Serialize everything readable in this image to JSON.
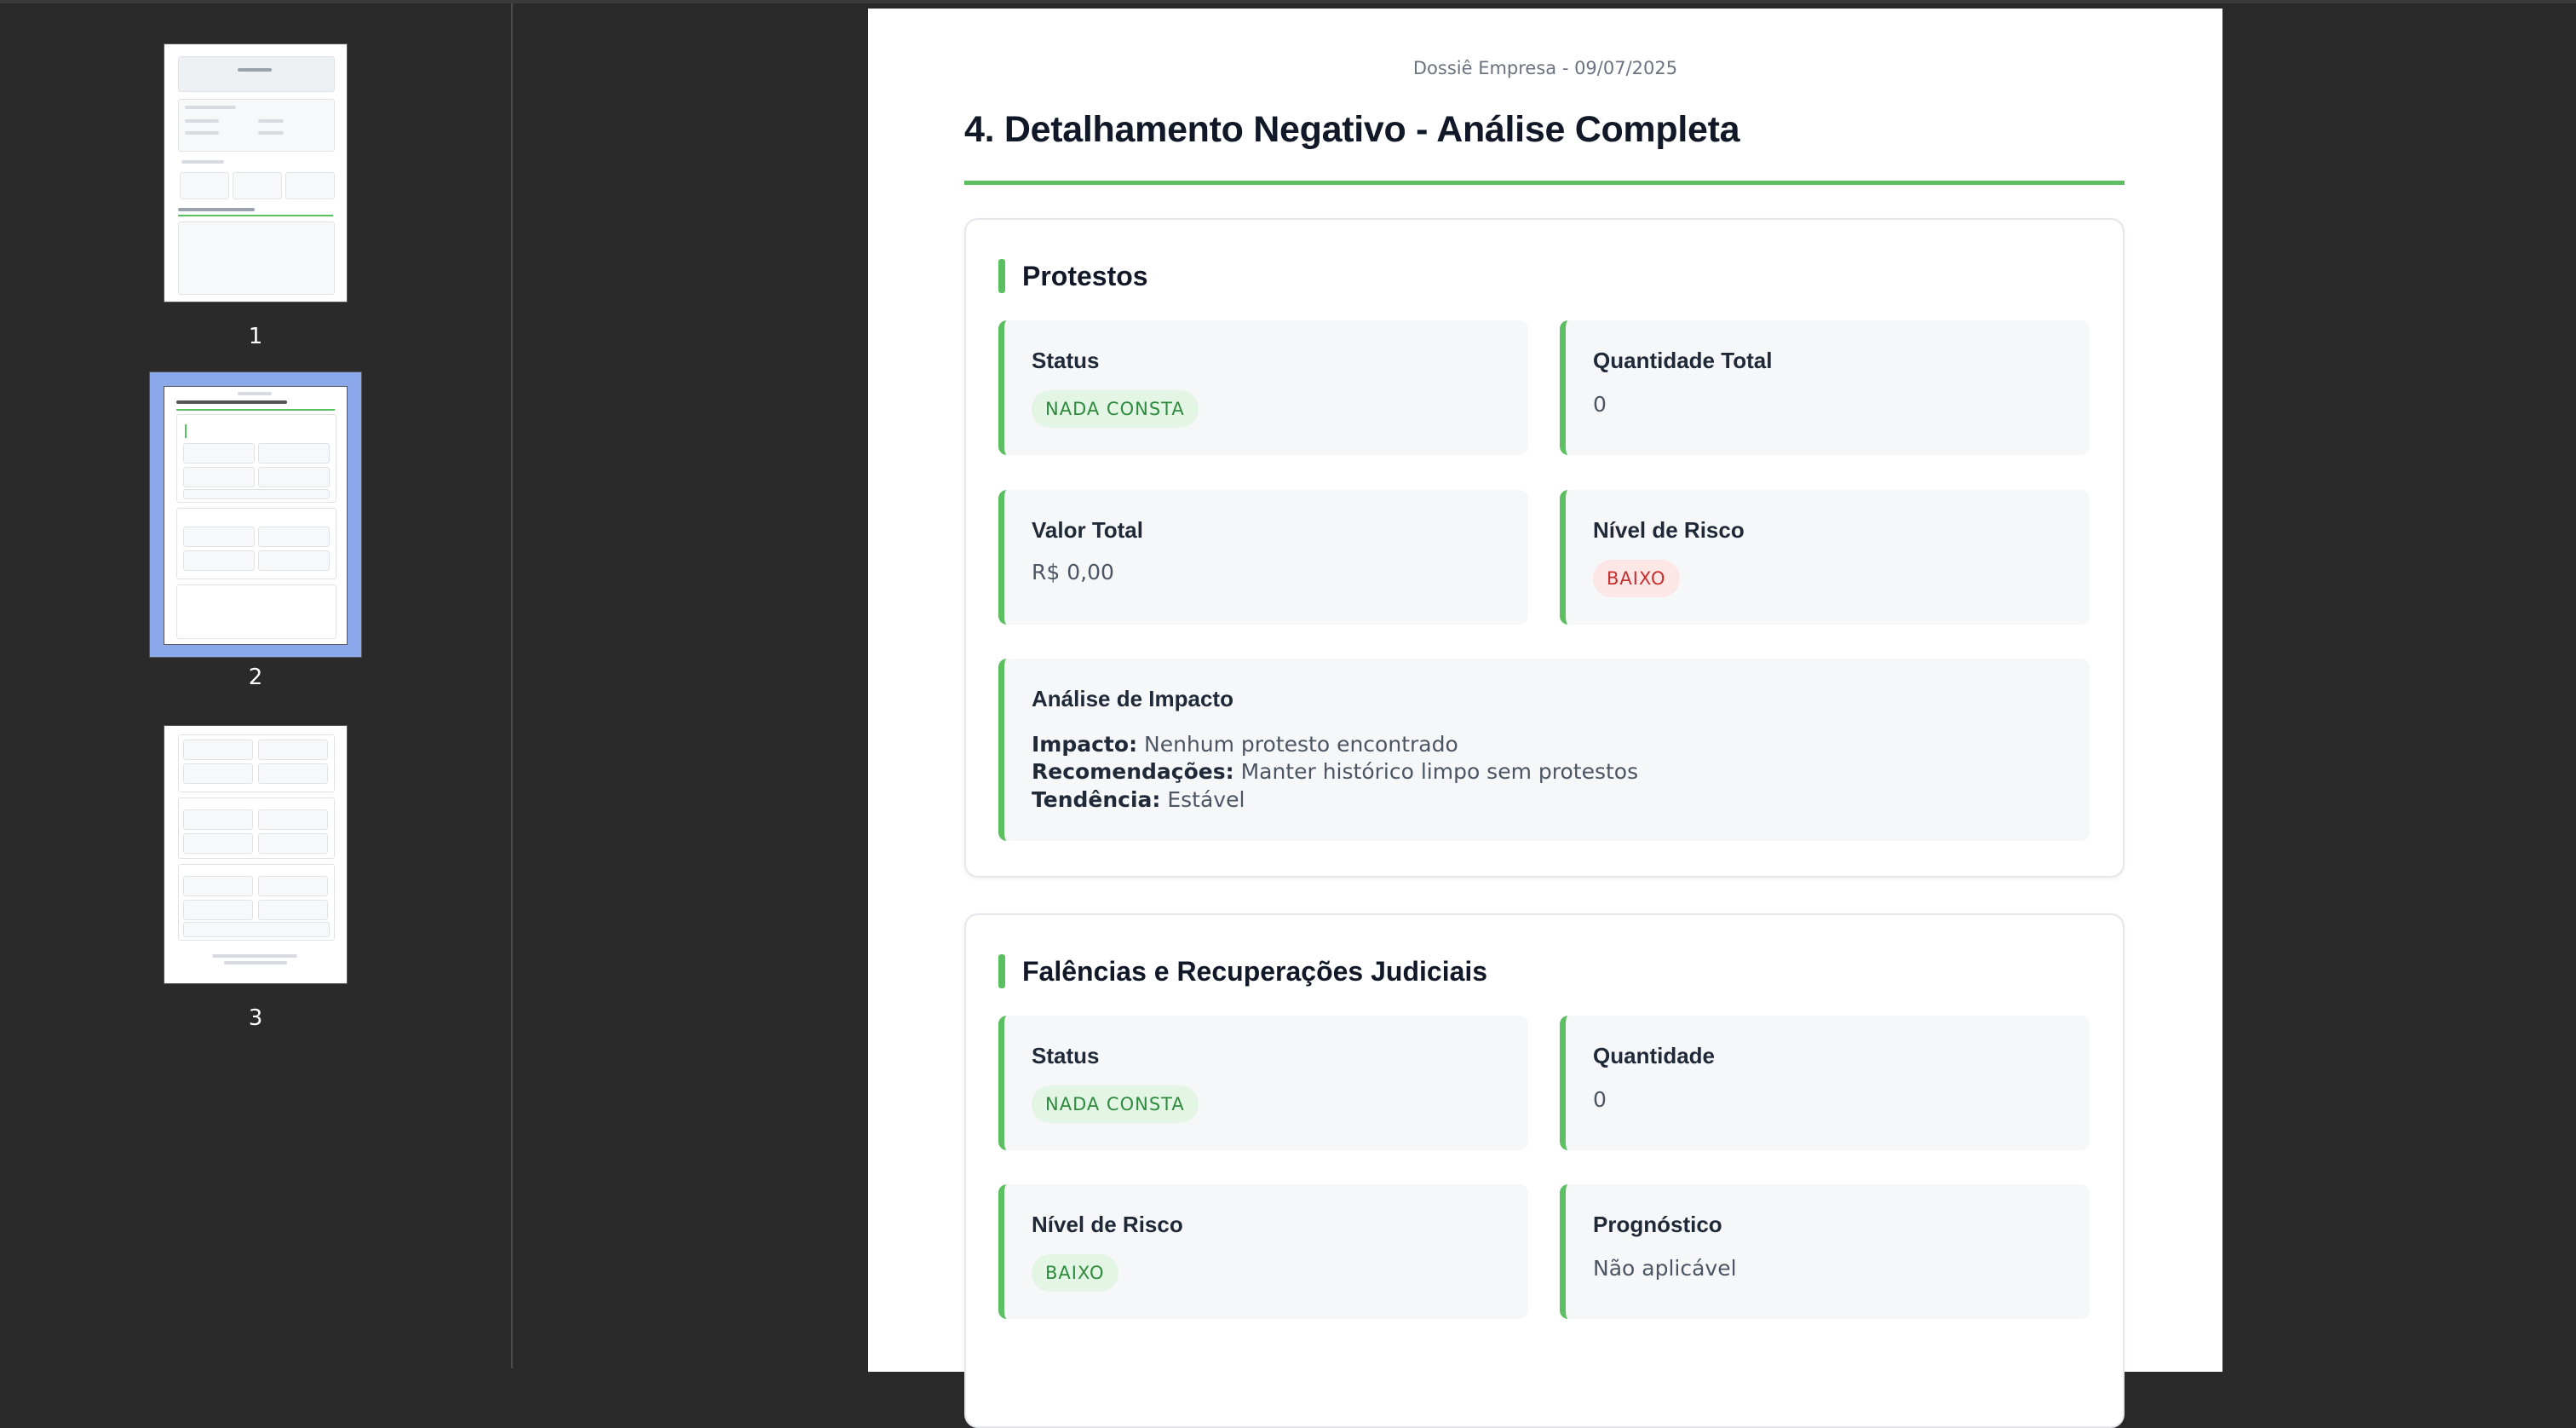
{
  "sidebar": {
    "thumbnails": [
      {
        "page": "1"
      },
      {
        "page": "2"
      },
      {
        "page": "3"
      }
    ]
  },
  "document": {
    "header": "Dossiê Empresa - 09/07/2025",
    "title": "4. Detalhamento Negativo - Análise Completa",
    "protestos": {
      "heading": "Protestos",
      "status_label": "Status",
      "status_value": "NADA CONSTA",
      "qty_label": "Quantidade Total",
      "qty_value": "0",
      "valor_label": "Valor Total",
      "valor_value": "R$ 0,00",
      "risco_label": "Nível de Risco",
      "risco_value": "BAIXO",
      "impact_title": "Análise de Impacto",
      "impacto_key": "Impacto:",
      "impacto_val": "Nenhum protesto encontrado",
      "recom_key": "Recomendações:",
      "recom_val": "Manter histórico limpo sem protestos",
      "tend_key": "Tendência:",
      "tend_val": "Estável"
    },
    "falencias": {
      "heading": "Falências e Recuperações Judiciais",
      "status_label": "Status",
      "status_value": "NADA CONSTA",
      "qty_label": "Quantidade",
      "qty_value": "0",
      "risco_label": "Nível de Risco",
      "risco_value": "BAIXO",
      "prog_label": "Prognóstico",
      "prog_value": "Não aplicável"
    }
  },
  "colors": {
    "accent": "#5cc063",
    "badge_ok_bg": "#e3f6e5",
    "badge_ok_text": "#2e8a3c",
    "badge_red_bg": "#fde6e6",
    "badge_red_text": "#c53030"
  }
}
